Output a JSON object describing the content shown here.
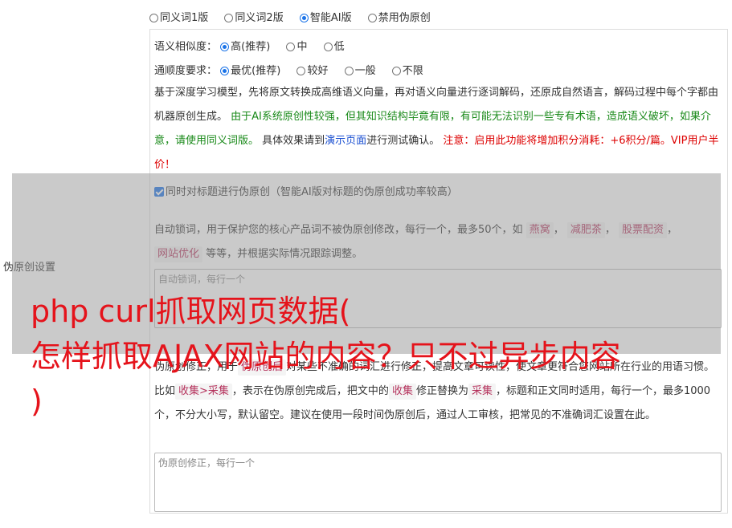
{
  "version_options": [
    {
      "label": "同义词1版",
      "checked": false
    },
    {
      "label": "同义词2版",
      "checked": false
    },
    {
      "label": "智能AI版",
      "checked": true
    },
    {
      "label": "禁用伪原创",
      "checked": false
    }
  ],
  "side_label": "伪原创设置",
  "similarity": {
    "label": "语义相似度：",
    "options": [
      {
        "label": "高(推荐)",
        "checked": true
      },
      {
        "label": "中",
        "checked": false
      },
      {
        "label": "低",
        "checked": false
      }
    ]
  },
  "fluency": {
    "label": "通顺度要求：",
    "options": [
      {
        "label": "最优(推荐)",
        "checked": true
      },
      {
        "label": "较好",
        "checked": false
      },
      {
        "label": "一般",
        "checked": false
      },
      {
        "label": "不限",
        "checked": false
      }
    ]
  },
  "description": {
    "intro": "基于深度学习模型，先将原文转换成高维语义向量，再对语义向量进行逐词解码，还原成自然语言，解码过程中每个字都由机器原创生成。",
    "warning_green": "由于AI系统原创性较强，但其知识结构毕竟有限，有可能无法识别一些专有术语，造成语义破坏，如果介意，请使用同义词版。",
    "effect_prefix": "具体效果请到",
    "demo_link": "演示页面",
    "effect_suffix": "进行测试确认。",
    "cost_red": "注意：启用此功能将增加积分消耗：+6积分/篇。VIP用户半价！"
  },
  "title_checkbox": {
    "label": "同时对标题进行伪原创（智能AI版对标题的伪原创成功率较高）",
    "checked": true
  },
  "lock_words": {
    "desc_prefix": "自动锁词，用于保护您的核心产品词不被伪原创修改，每行一个，最多50个，如",
    "examples": [
      "燕窝",
      "减肥茶",
      "股票配资",
      "网站优化"
    ],
    "desc_suffix": "等等，并根据实际情况跟踪调整。",
    "placeholder": "自动锁词，每行一个"
  },
  "correction": {
    "desc_1": "伪原创修正，用于",
    "tag_1": "伪原创后",
    "desc_2": "对某些不准确的词汇进行修正，提高文章可读性，使文章更符合您网站所在行业的用语习惯。比如",
    "tag_2": "收集>采集",
    "desc_3": "，表示在伪原创完成后，把文中的",
    "tag_3": "收集",
    "desc_4": "修正替换为",
    "tag_4": "采集",
    "desc_5": "，标题和正文同时适用，每行一个，最多1000个，不分大小写，默认留空。建议在使用一段时间伪原创后，通过人工审核，把常见的不准确词汇设置在此。",
    "placeholder": "伪原创修正，每行一个"
  },
  "watermark": {
    "line1": "php curl抓取网页数据(",
    "line2": "怎样抓取AJAX网站的内容？只不过异步内容",
    "line3": ")"
  },
  "colors": {
    "accent": "#1a73e8",
    "green": "#1a8a1a",
    "red": "#dd0000",
    "watermark": "#e5131b"
  }
}
